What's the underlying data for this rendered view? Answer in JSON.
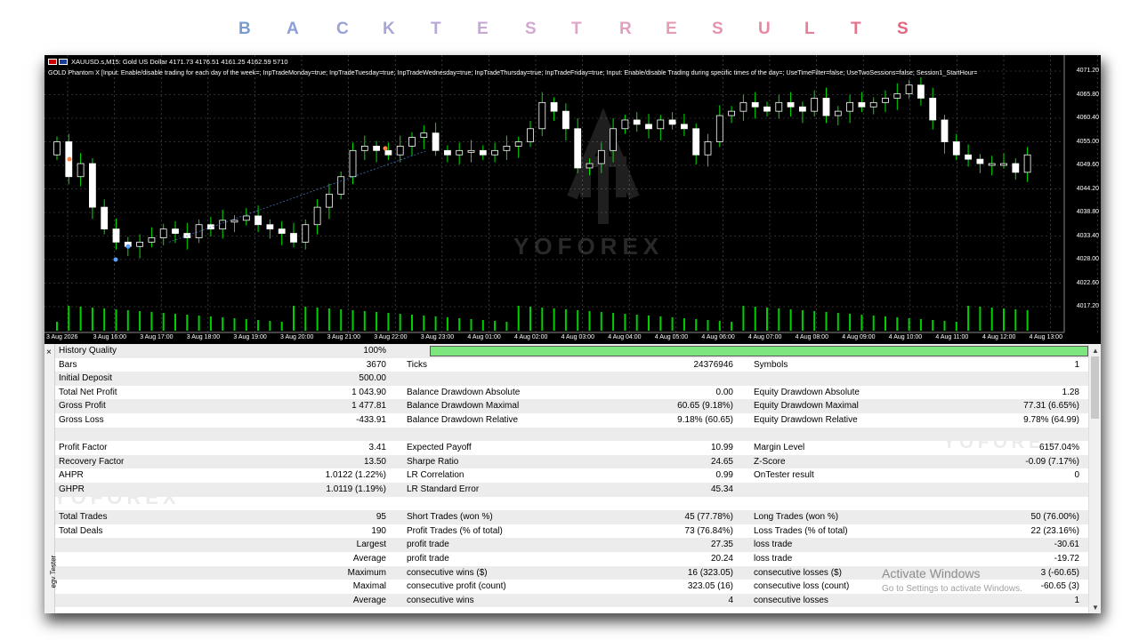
{
  "title_letters": [
    "B",
    "A",
    "C",
    "K",
    "T",
    "E",
    "S",
    "T",
    "R",
    "E",
    "S",
    "U",
    "L",
    "T",
    "S"
  ],
  "title_colors": [
    "#7a9bd0",
    "#8aa0d6",
    "#9aa3d8",
    "#a8a5da",
    "#b8a8d8",
    "#c6a8d4",
    "#d4a8d0",
    "#dea5c8",
    "#e2a0c0",
    "#e49cb8",
    "#e694ae",
    "#e68aa4",
    "#e67f98",
    "#e6738c",
    "#e66680"
  ],
  "chart": {
    "symbol_line": "XAUUSD.s,M15:  Gold US Dollar  4171.73  4176.51  4161.25  4162.59  5710",
    "params_line": "GOLD Phantom X [Input: Enable/disable trading for each day of the week=; InpTradeMonday=true; InpTradeTuesday=true; InpTradeWednesday=true; InpTradeThursday=true; InpTradeFriday=true; Input: Enable/disable Trading during specific times of the day=; UseTimeFilter=false; UseTwoSessions=false; Session1_StartHour=",
    "watermark": "YOFOREX",
    "price_levels": [
      "4071.20",
      "4065.80",
      "4060.40",
      "4055.00",
      "4049.60",
      "4044.20",
      "4038.80",
      "4033.40",
      "4028.00",
      "4022.60",
      "4017.20"
    ],
    "time_labels": [
      "3 Aug 2026",
      "3 Aug 16:00",
      "3 Aug 17:00",
      "3 Aug 18:00",
      "3 Aug 19:00",
      "3 Aug 20:00",
      "3 Aug 21:00",
      "3 Aug 22:00",
      "3 Aug 23:00",
      "4 Aug 01:00",
      "4 Aug 02:00",
      "4 Aug 03:00",
      "4 Aug 04:00",
      "4 Aug 05:00",
      "4 Aug 06:00",
      "4 Aug 07:00",
      "4 Aug 08:00",
      "4 Aug 09:00",
      "4 Aug 10:00",
      "4 Aug 11:00",
      "4 Aug 12:00",
      "4 Aug 13:00"
    ],
    "colors": {
      "bg": "#000000",
      "grid": "#5a5a5a",
      "candle": "#ffffff",
      "wick": "#00e000",
      "volume": "#00d000"
    }
  },
  "report": {
    "close_glyph": "×",
    "side_label": "egy Tester",
    "history_quality": {
      "label": "History Quality",
      "value": "100%",
      "fill": 1.0
    },
    "rows": [
      {
        "c1": "Bars",
        "c2": "3670",
        "c3": "Ticks",
        "c4": "24376946",
        "c5": "Symbols",
        "c6": "1"
      },
      {
        "c1": "Initial Deposit",
        "c2": "500.00",
        "c3": "",
        "c4": "",
        "c5": "",
        "c6": ""
      },
      {
        "c1": "Total Net Profit",
        "c2": "1 043.90",
        "c3": "Balance Drawdown Absolute",
        "c4": "0.00",
        "c5": "Equity Drawdown Absolute",
        "c6": "1.28"
      },
      {
        "c1": "Gross Profit",
        "c2": "1 477.81",
        "c3": "Balance Drawdown Maximal",
        "c4": "60.65 (9.18%)",
        "c5": "Equity Drawdown Maximal",
        "c6": "77.31 (6.65%)"
      },
      {
        "c1": "Gross Loss",
        "c2": "-433.91",
        "c3": "Balance Drawdown Relative",
        "c4": "9.18% (60.65)",
        "c5": "Equity Drawdown Relative",
        "c6": "9.78% (64.99)"
      },
      {
        "c1": "",
        "c2": "",
        "c3": "",
        "c4": "",
        "c5": "",
        "c6": ""
      },
      {
        "c1": "Profit Factor",
        "c2": "3.41",
        "c3": "Expected Payoff",
        "c4": "10.99",
        "c5": "Margin Level",
        "c6": "6157.04%"
      },
      {
        "c1": "Recovery Factor",
        "c2": "13.50",
        "c3": "Sharpe Ratio",
        "c4": "24.65",
        "c5": "Z-Score",
        "c6": "-0.09 (7.17%)"
      },
      {
        "c1": "AHPR",
        "c2": "1.0122 (1.22%)",
        "c3": "LR Correlation",
        "c4": "0.99",
        "c5": "OnTester result",
        "c6": "0"
      },
      {
        "c1": "GHPR",
        "c2": "1.0119 (1.19%)",
        "c3": "LR Standard Error",
        "c4": "45.34",
        "c5": "",
        "c6": ""
      },
      {
        "c1": "",
        "c2": "",
        "c3": "",
        "c4": "",
        "c5": "",
        "c6": ""
      },
      {
        "c1": "Total Trades",
        "c2": "95",
        "c3": "Short Trades (won %)",
        "c4": "45 (77.78%)",
        "c5": "Long Trades (won %)",
        "c6": "50 (76.00%)"
      },
      {
        "c1": "Total Deals",
        "c2": "190",
        "c3": "Profit Trades (% of total)",
        "c4": "73 (76.84%)",
        "c5": "Loss Trades (% of total)",
        "c6": "22 (23.16%)"
      },
      {
        "c1": "",
        "c2": "Largest",
        "c3": "profit trade",
        "c4": "27.35",
        "c5": "loss trade",
        "c6": "-30.61"
      },
      {
        "c1": "",
        "c2": "Average",
        "c3": "profit trade",
        "c4": "20.24",
        "c5": "loss trade",
        "c6": "-19.72"
      },
      {
        "c1": "",
        "c2": "Maximum",
        "c3": "consecutive wins ($)",
        "c4": "16 (323.05)",
        "c5": "consecutive losses ($)",
        "c6": "3 (-60.65)"
      },
      {
        "c1": "",
        "c2": "Maximal",
        "c3": "consecutive profit (count)",
        "c4": "323.05 (16)",
        "c5": "consecutive loss (count)",
        "c6": "-60.65 (3)"
      },
      {
        "c1": "",
        "c2": "Average",
        "c3": "consecutive wins",
        "c4": "4",
        "c5": "consecutive losses",
        "c6": "1"
      }
    ],
    "watermark": "YOFOREX",
    "activate_title": "Activate Windows",
    "activate_sub": "Go to Settings to activate Windows."
  }
}
